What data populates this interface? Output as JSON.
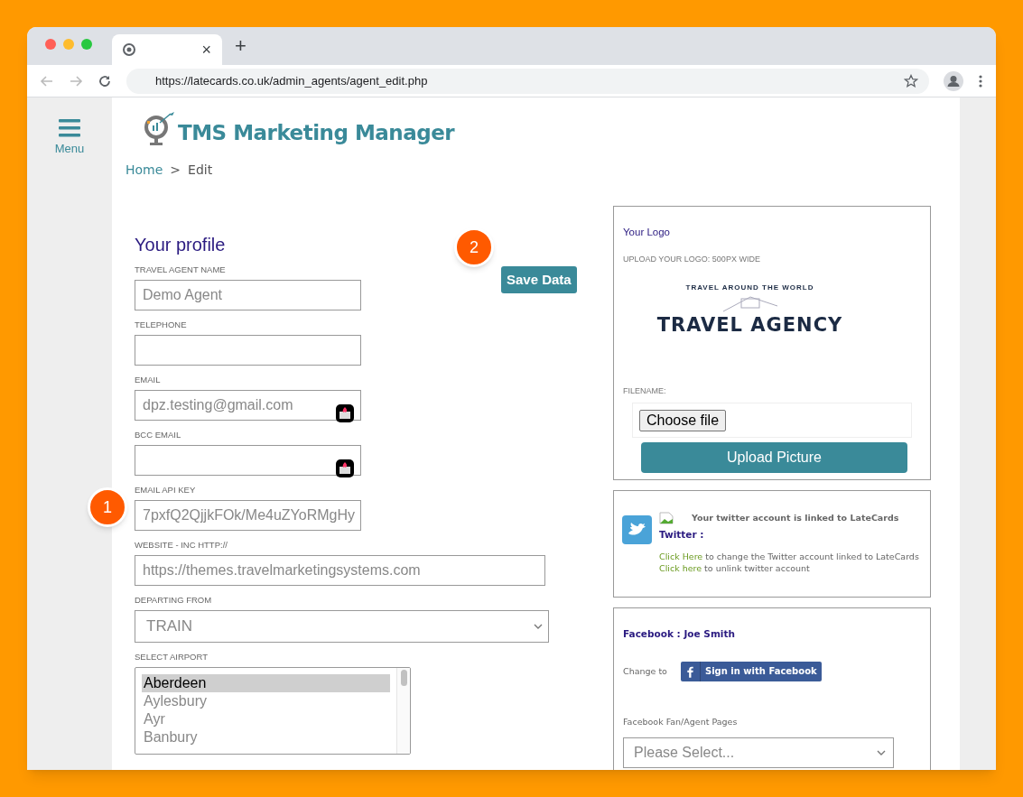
{
  "browser": {
    "tab_close": "×",
    "new_tab": "+",
    "url": "https://latecards.co.uk/admin_agents/agent_edit.php"
  },
  "sidebar": {
    "menu_label": "Menu"
  },
  "header": {
    "app_title": "TMS Marketing Manager"
  },
  "breadcrumb": {
    "items": [
      "Home",
      "Edit"
    ],
    "separator": ">"
  },
  "profile": {
    "title": "Your profile",
    "save_button": "Save Data",
    "fields": [
      {
        "kind": "text",
        "label": "TRAVEL AGENT NAME",
        "value": "Demo Agent",
        "autofill_icon": false
      },
      {
        "kind": "text",
        "label": "TELEPHONE",
        "autofill_icon": false
      },
      {
        "kind": "text",
        "label": "EMAIL",
        "value": "dpz.testing@gmail.com",
        "autofill_icon": true
      },
      {
        "kind": "text",
        "label": "BCC EMAIL",
        "autofill_icon": true
      },
      {
        "kind": "text",
        "label": "EMAIL API KEY",
        "value": "7pxfQ2QjjkFOk/Me4uZYoRMgHy",
        "autofill_icon": false
      },
      {
        "kind": "url",
        "label": "WEBSITE - INC HTTP://",
        "value": "https://themes.travelmarketingsystems.com"
      },
      {
        "kind": "select",
        "label": "DEPARTING FROM",
        "value": "TRAIN"
      },
      {
        "kind": "listbox",
        "label": "SELECT AIRPORT",
        "options": [
          {
            "label": "Aberdeen",
            "selected": true
          },
          {
            "label": "Aylesbury",
            "selected": false
          },
          {
            "label": "Ayr",
            "selected": false
          },
          {
            "label": "Banbury",
            "selected": false
          }
        ]
      }
    ]
  },
  "logo_panel": {
    "title": "Your Logo",
    "hint": "UPLOAD YOUR LOGO: 500PX WIDE",
    "logo_tagline": "TRAVEL AROUND THE WORLD",
    "logo_name": "TRAVEL AGENCY",
    "filename_label": "FILENAME:",
    "choose_button": "Choose file",
    "upload_button": "Upload Picture"
  },
  "twitter_panel": {
    "status": "Your twitter account is linked to LateCards",
    "heading": "Twitter :",
    "lines": [
      {
        "link": "Click Here",
        "text": "to change the Twitter account linked to LateCards"
      },
      {
        "link": "Click here",
        "text": "to unlink twitter account"
      }
    ]
  },
  "facebook_panel": {
    "heading": "Facebook : Joe Smith",
    "change_label": "Change to",
    "signin_button": "Sign in with Facebook",
    "pages_label": "Facebook Fan/Agent Pages",
    "pages_placeholder": "Please Select..."
  },
  "annotations": [
    {
      "number": "1"
    },
    {
      "number": "2"
    }
  ]
}
